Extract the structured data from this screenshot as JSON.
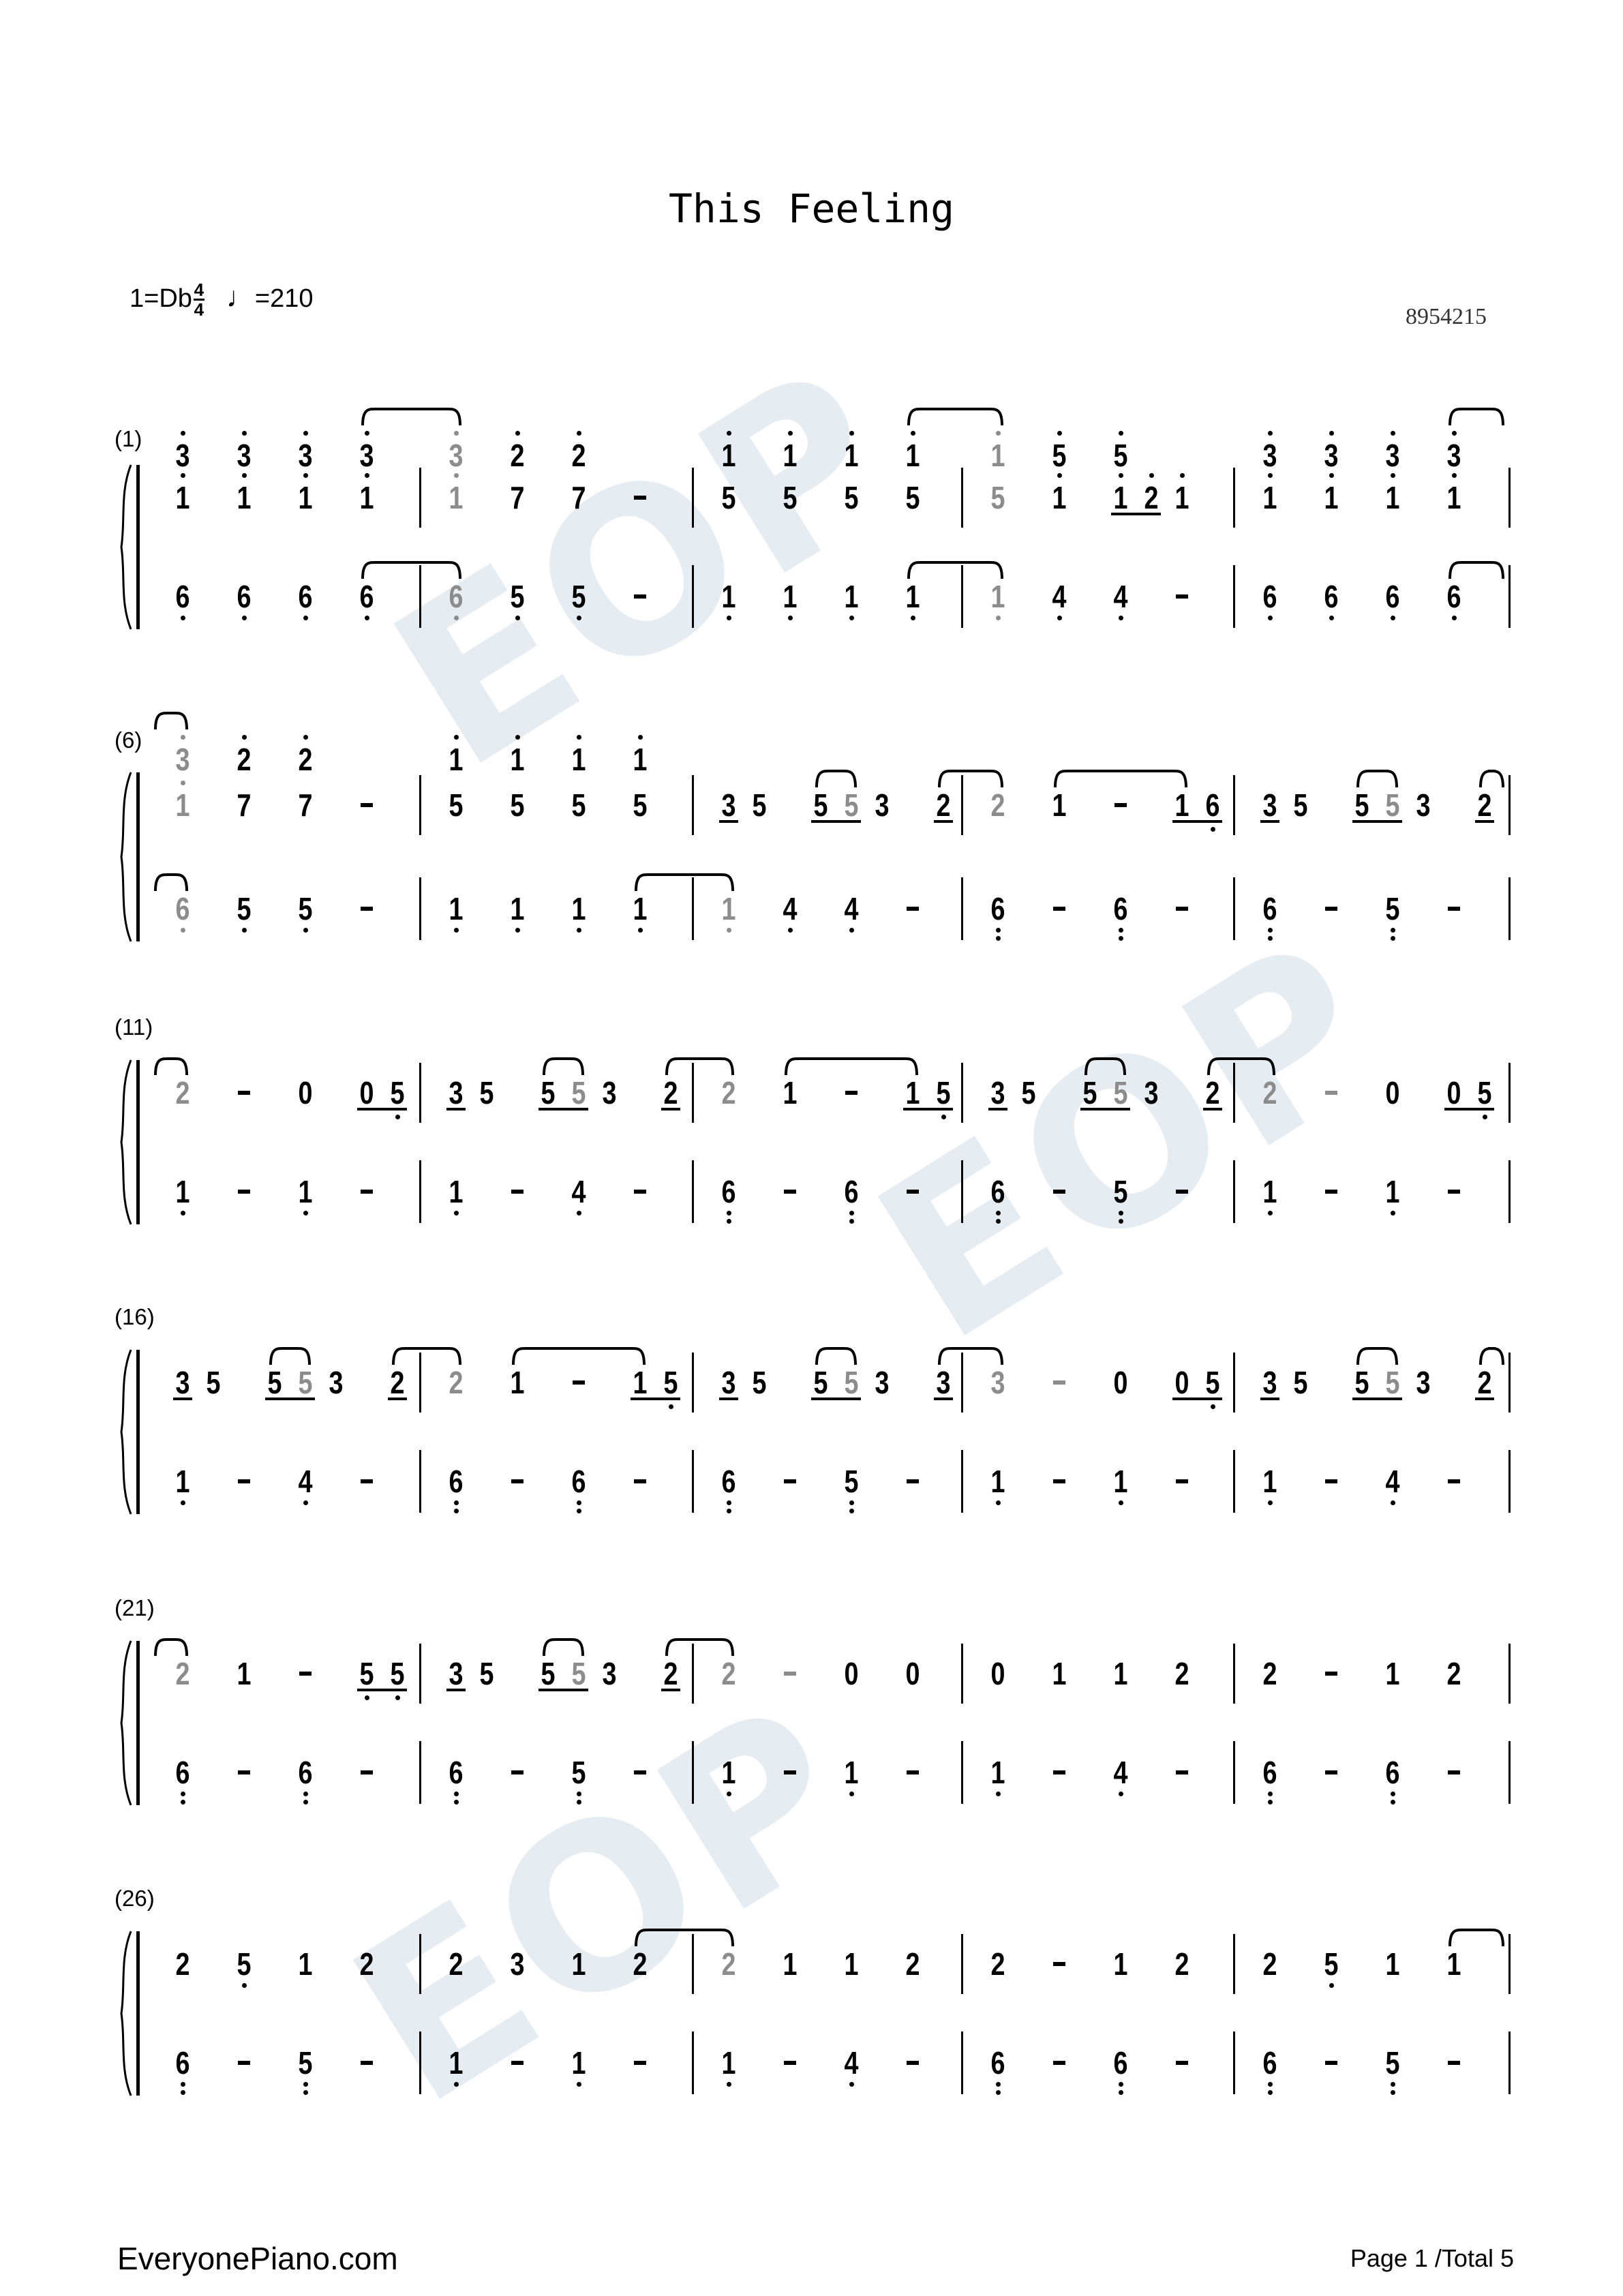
{
  "title": "This Feeling",
  "key": {
    "tonic": "1=Db",
    "time_top": "4",
    "time_bottom": "4",
    "tempo_note": "♩",
    "tempo": "=210"
  },
  "sheet_id": "8954215",
  "watermark": "EOP",
  "footer": {
    "site": "EveryonePiano.com",
    "page": "Page 1 /Total 5"
  },
  "colors": {
    "ink": "#000000",
    "tied_note": "#8c8c8c",
    "watermark": "#e6edf2"
  },
  "notation_legend": {
    "'": "upper octave dot",
    ",": "lower octave dot",
    "u": "underlined (eighth)",
    "g": "gray tied note",
    "^": "slur to next note",
    "<": "slur continued from previous line"
  },
  "systems": [
    {
      "label": "(1)",
      "top": [
        [
          "3'",
          "3'",
          "3'",
          "3'^"
        ],
        [
          "g3'",
          "2'",
          "2'"
        ],
        [
          "1'",
          "1'",
          "1'",
          "1'^"
        ],
        [
          "g1'",
          "5'",
          "5'"
        ],
        [
          "3'",
          "3'",
          "3'",
          "3'^"
        ]
      ],
      "mid": [
        [
          "1'",
          "1'",
          "1'",
          "1'"
        ],
        [
          "g1'",
          "7",
          "7",
          "-"
        ],
        [
          "5",
          "5",
          "5",
          "5"
        ],
        [
          "g5",
          "1'",
          "u1'",
          "u2'",
          "1'"
        ],
        [
          "1'",
          "1'",
          "1'",
          "1'"
        ]
      ],
      "bass": [
        [
          "6,",
          "6,",
          "6,",
          "6,^"
        ],
        [
          "g6,",
          "5,",
          "5,",
          "-"
        ],
        [
          "1,",
          "1,",
          "1,",
          "1,^"
        ],
        [
          "g1,",
          "4,",
          "4,",
          "-"
        ],
        [
          "6,",
          "6,",
          "6,",
          "6,^"
        ]
      ]
    },
    {
      "label": "(6)",
      "top": [
        [
          "<g3'",
          "2'",
          "2'"
        ],
        [
          "1'",
          "1'",
          "1'",
          "1'"
        ],
        [],
        [],
        []
      ],
      "mid": [
        [
          "g1'",
          "7",
          "7",
          "-"
        ],
        [
          "5",
          "5",
          "5",
          "5"
        ],
        [
          "u3",
          "5",
          "u5^",
          "ug5",
          "3",
          "u2^"
        ],
        [
          "g2",
          "1^",
          "-",
          "u1",
          "u6,"
        ],
        [
          "u3",
          "5",
          "u5^",
          "ug5",
          "3",
          "u2^"
        ]
      ],
      "bass": [
        [
          "<g6,",
          "5,",
          "5,",
          "-"
        ],
        [
          "1,",
          "1,",
          "1,",
          "1,^"
        ],
        [
          "g1,",
          "4,",
          "4,",
          "-"
        ],
        [
          "6,,",
          "-",
          "6,,",
          "-"
        ],
        [
          "6,,",
          "-",
          "5,,",
          "-"
        ]
      ]
    },
    {
      "label": "(11)",
      "mid": [
        [
          "<g2",
          "-",
          "0",
          "u0",
          "u5,"
        ],
        [
          "u3",
          "5",
          "u5^",
          "ug5",
          "3",
          "u2^"
        ],
        [
          "g2",
          "1^",
          "-",
          "u1",
          "u5,"
        ],
        [
          "u3",
          "5",
          "u5^",
          "ug5",
          "3",
          "u2^"
        ],
        [
          "g2",
          "g-",
          "0",
          "u0",
          "u5,"
        ]
      ],
      "bass": [
        [
          "1,",
          "-",
          "1,",
          "-"
        ],
        [
          "1,",
          "-",
          "4,",
          "-"
        ],
        [
          "6,,",
          "-",
          "6,,",
          "-"
        ],
        [
          "6,,",
          "-",
          "5,,",
          "-"
        ],
        [
          "1,",
          "-",
          "1,",
          "-"
        ]
      ]
    },
    {
      "label": "(16)",
      "mid": [
        [
          "u3",
          "5",
          "u5^",
          "ug5",
          "3",
          "u2^"
        ],
        [
          "g2",
          "1^",
          "-",
          "u1",
          "u5,"
        ],
        [
          "u3",
          "5",
          "u5^",
          "ug5",
          "3",
          "u3^"
        ],
        [
          "g3",
          "g-",
          "0",
          "u0",
          "u5,"
        ],
        [
          "u3",
          "5",
          "u5^",
          "ug5",
          "3",
          "u2^"
        ]
      ],
      "bass": [
        [
          "1,",
          "-",
          "4,",
          "-"
        ],
        [
          "6,,",
          "-",
          "6,,",
          "-"
        ],
        [
          "6,,",
          "-",
          "5,,",
          "-"
        ],
        [
          "1,",
          "-",
          "1,",
          "-"
        ],
        [
          "1,",
          "-",
          "4,",
          "-"
        ]
      ]
    },
    {
      "label": "(21)",
      "mid": [
        [
          "<g2",
          "1",
          "-",
          "u5,",
          "u5,"
        ],
        [
          "u3",
          "5",
          "u5^",
          "ug5",
          "3",
          "u2^"
        ],
        [
          "g2",
          "g-",
          "0",
          "0"
        ],
        [
          "0",
          "1",
          "1",
          "2"
        ],
        [
          "2",
          "-",
          "1",
          "2"
        ]
      ],
      "bass": [
        [
          "6,,",
          "-",
          "6,,",
          "-"
        ],
        [
          "6,,",
          "-",
          "5,,",
          "-"
        ],
        [
          "1,",
          "-",
          "1,",
          "-"
        ],
        [
          "1,",
          "-",
          "4,",
          "-"
        ],
        [
          "6,,",
          "-",
          "6,,",
          "-"
        ]
      ]
    },
    {
      "label": "(26)",
      "mid": [
        [
          "2",
          "5,",
          "1",
          "2"
        ],
        [
          "2",
          "3",
          "1",
          "2^"
        ],
        [
          "g2",
          "1",
          "1",
          "2"
        ],
        [
          "2",
          "-",
          "1",
          "2"
        ],
        [
          "2",
          "5,",
          "1",
          "1^"
        ]
      ],
      "bass": [
        [
          "6,,",
          "-",
          "5,,",
          "-"
        ],
        [
          "1,",
          "-",
          "1,",
          "-"
        ],
        [
          "1,",
          "-",
          "4,",
          "-"
        ],
        [
          "6,,",
          "-",
          "6,,",
          "-"
        ],
        [
          "6,,",
          "-",
          "5,,",
          "-"
        ]
      ]
    }
  ]
}
